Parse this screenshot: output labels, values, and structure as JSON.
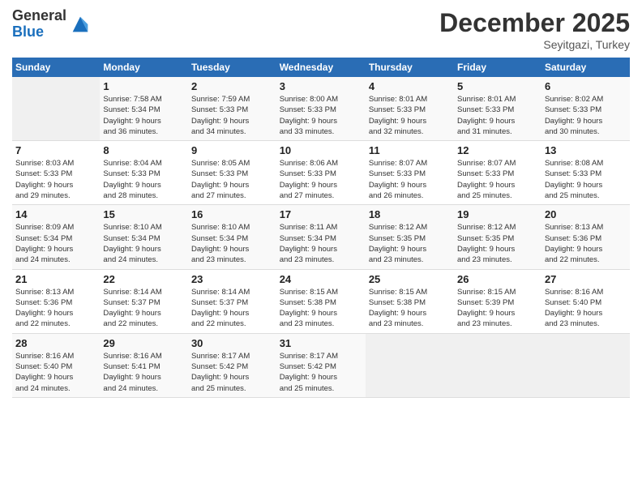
{
  "header": {
    "logo_line1": "General",
    "logo_line2": "Blue",
    "month": "December 2025",
    "location": "Seyitgazi, Turkey"
  },
  "days_of_week": [
    "Sunday",
    "Monday",
    "Tuesday",
    "Wednesday",
    "Thursday",
    "Friday",
    "Saturday"
  ],
  "weeks": [
    [
      {
        "num": "",
        "info": ""
      },
      {
        "num": "1",
        "info": "Sunrise: 7:58 AM\nSunset: 5:34 PM\nDaylight: 9 hours\nand 36 minutes."
      },
      {
        "num": "2",
        "info": "Sunrise: 7:59 AM\nSunset: 5:33 PM\nDaylight: 9 hours\nand 34 minutes."
      },
      {
        "num": "3",
        "info": "Sunrise: 8:00 AM\nSunset: 5:33 PM\nDaylight: 9 hours\nand 33 minutes."
      },
      {
        "num": "4",
        "info": "Sunrise: 8:01 AM\nSunset: 5:33 PM\nDaylight: 9 hours\nand 32 minutes."
      },
      {
        "num": "5",
        "info": "Sunrise: 8:01 AM\nSunset: 5:33 PM\nDaylight: 9 hours\nand 31 minutes."
      },
      {
        "num": "6",
        "info": "Sunrise: 8:02 AM\nSunset: 5:33 PM\nDaylight: 9 hours\nand 30 minutes."
      }
    ],
    [
      {
        "num": "7",
        "info": "Sunrise: 8:03 AM\nSunset: 5:33 PM\nDaylight: 9 hours\nand 29 minutes."
      },
      {
        "num": "8",
        "info": "Sunrise: 8:04 AM\nSunset: 5:33 PM\nDaylight: 9 hours\nand 28 minutes."
      },
      {
        "num": "9",
        "info": "Sunrise: 8:05 AM\nSunset: 5:33 PM\nDaylight: 9 hours\nand 27 minutes."
      },
      {
        "num": "10",
        "info": "Sunrise: 8:06 AM\nSunset: 5:33 PM\nDaylight: 9 hours\nand 27 minutes."
      },
      {
        "num": "11",
        "info": "Sunrise: 8:07 AM\nSunset: 5:33 PM\nDaylight: 9 hours\nand 26 minutes."
      },
      {
        "num": "12",
        "info": "Sunrise: 8:07 AM\nSunset: 5:33 PM\nDaylight: 9 hours\nand 25 minutes."
      },
      {
        "num": "13",
        "info": "Sunrise: 8:08 AM\nSunset: 5:33 PM\nDaylight: 9 hours\nand 25 minutes."
      }
    ],
    [
      {
        "num": "14",
        "info": "Sunrise: 8:09 AM\nSunset: 5:34 PM\nDaylight: 9 hours\nand 24 minutes."
      },
      {
        "num": "15",
        "info": "Sunrise: 8:10 AM\nSunset: 5:34 PM\nDaylight: 9 hours\nand 24 minutes."
      },
      {
        "num": "16",
        "info": "Sunrise: 8:10 AM\nSunset: 5:34 PM\nDaylight: 9 hours\nand 23 minutes."
      },
      {
        "num": "17",
        "info": "Sunrise: 8:11 AM\nSunset: 5:34 PM\nDaylight: 9 hours\nand 23 minutes."
      },
      {
        "num": "18",
        "info": "Sunrise: 8:12 AM\nSunset: 5:35 PM\nDaylight: 9 hours\nand 23 minutes."
      },
      {
        "num": "19",
        "info": "Sunrise: 8:12 AM\nSunset: 5:35 PM\nDaylight: 9 hours\nand 23 minutes."
      },
      {
        "num": "20",
        "info": "Sunrise: 8:13 AM\nSunset: 5:36 PM\nDaylight: 9 hours\nand 22 minutes."
      }
    ],
    [
      {
        "num": "21",
        "info": "Sunrise: 8:13 AM\nSunset: 5:36 PM\nDaylight: 9 hours\nand 22 minutes."
      },
      {
        "num": "22",
        "info": "Sunrise: 8:14 AM\nSunset: 5:37 PM\nDaylight: 9 hours\nand 22 minutes."
      },
      {
        "num": "23",
        "info": "Sunrise: 8:14 AM\nSunset: 5:37 PM\nDaylight: 9 hours\nand 22 minutes."
      },
      {
        "num": "24",
        "info": "Sunrise: 8:15 AM\nSunset: 5:38 PM\nDaylight: 9 hours\nand 23 minutes."
      },
      {
        "num": "25",
        "info": "Sunrise: 8:15 AM\nSunset: 5:38 PM\nDaylight: 9 hours\nand 23 minutes."
      },
      {
        "num": "26",
        "info": "Sunrise: 8:15 AM\nSunset: 5:39 PM\nDaylight: 9 hours\nand 23 minutes."
      },
      {
        "num": "27",
        "info": "Sunrise: 8:16 AM\nSunset: 5:40 PM\nDaylight: 9 hours\nand 23 minutes."
      }
    ],
    [
      {
        "num": "28",
        "info": "Sunrise: 8:16 AM\nSunset: 5:40 PM\nDaylight: 9 hours\nand 24 minutes."
      },
      {
        "num": "29",
        "info": "Sunrise: 8:16 AM\nSunset: 5:41 PM\nDaylight: 9 hours\nand 24 minutes."
      },
      {
        "num": "30",
        "info": "Sunrise: 8:17 AM\nSunset: 5:42 PM\nDaylight: 9 hours\nand 25 minutes."
      },
      {
        "num": "31",
        "info": "Sunrise: 8:17 AM\nSunset: 5:42 PM\nDaylight: 9 hours\nand 25 minutes."
      },
      {
        "num": "",
        "info": ""
      },
      {
        "num": "",
        "info": ""
      },
      {
        "num": "",
        "info": ""
      }
    ]
  ]
}
